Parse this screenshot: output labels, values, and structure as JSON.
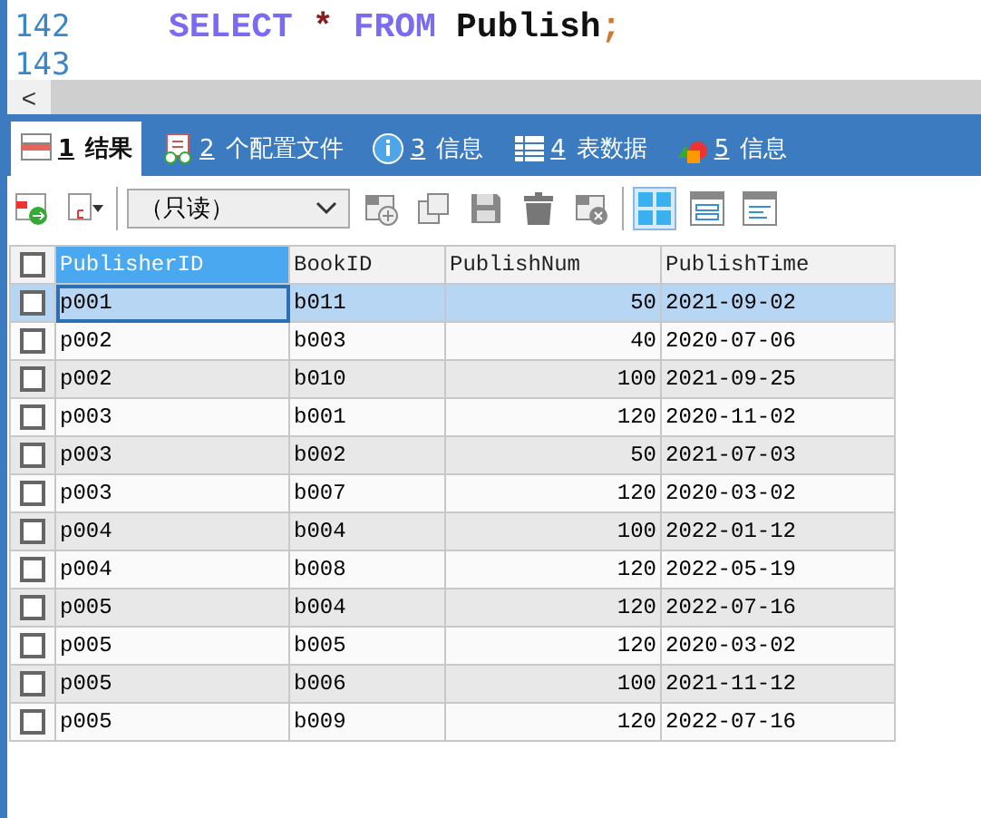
{
  "editor": {
    "lines": [
      {
        "number": "142",
        "tokens": [
          {
            "kind": "keyword",
            "text": "SELECT"
          },
          {
            "kind": "operator",
            "text": "*"
          },
          {
            "kind": "keyword",
            "text": "FROM"
          },
          {
            "kind": "name",
            "text": "Publish"
          },
          {
            "kind": "punct",
            "text": ";"
          }
        ]
      },
      {
        "number": "143"
      }
    ],
    "scroll_left": "<"
  },
  "tabs": [
    {
      "key": "1",
      "label": "结果",
      "selected": true
    },
    {
      "key": "2",
      "label": "个配置文件",
      "selected": false
    },
    {
      "key": "3",
      "label": "信息",
      "selected": false
    },
    {
      "key": "4",
      "label": "表数据",
      "selected": false
    },
    {
      "key": "5",
      "label": "信息",
      "selected": false
    }
  ],
  "toolbar": {
    "mode": "（只读）",
    "views": [
      {
        "selected": true
      },
      {
        "selected": false
      },
      {
        "selected": false
      }
    ]
  },
  "table": {
    "all_checked": false,
    "columns": [
      {
        "label": "PublisherID",
        "selected": true,
        "kind": "text"
      },
      {
        "label": "BookID",
        "selected": false,
        "kind": "text"
      },
      {
        "label": "PublishNum",
        "selected": false,
        "kind": "number"
      },
      {
        "label": "PublishTime",
        "selected": false,
        "kind": "text"
      }
    ],
    "rows": [
      {
        "selected": true,
        "checked": false,
        "cells": [
          "p001",
          "b011",
          "50",
          "2021-09-02"
        ]
      },
      {
        "selected": false,
        "checked": false,
        "cells": [
          "p002",
          "b003",
          "40",
          "2020-07-06"
        ]
      },
      {
        "selected": false,
        "checked": false,
        "cells": [
          "p002",
          "b010",
          "100",
          "2021-09-25"
        ]
      },
      {
        "selected": false,
        "checked": false,
        "cells": [
          "p003",
          "b001",
          "120",
          "2020-11-02"
        ]
      },
      {
        "selected": false,
        "checked": false,
        "cells": [
          "p003",
          "b002",
          "50",
          "2021-07-03"
        ]
      },
      {
        "selected": false,
        "checked": false,
        "cells": [
          "p003",
          "b007",
          "120",
          "2020-03-02"
        ]
      },
      {
        "selected": false,
        "checked": false,
        "cells": [
          "p004",
          "b004",
          "100",
          "2022-01-12"
        ]
      },
      {
        "selected": false,
        "checked": false,
        "cells": [
          "p004",
          "b008",
          "120",
          "2022-05-19"
        ]
      },
      {
        "selected": false,
        "checked": false,
        "cells": [
          "p005",
          "b004",
          "120",
          "2022-07-16"
        ]
      },
      {
        "selected": false,
        "checked": false,
        "cells": [
          "p005",
          "b005",
          "120",
          "2020-03-02"
        ]
      },
      {
        "selected": false,
        "checked": false,
        "cells": [
          "p005",
          "b006",
          "100",
          "2021-11-12"
        ]
      },
      {
        "selected": false,
        "checked": false,
        "cells": [
          "p005",
          "b009",
          "120",
          "2022-07-16"
        ]
      }
    ]
  }
}
